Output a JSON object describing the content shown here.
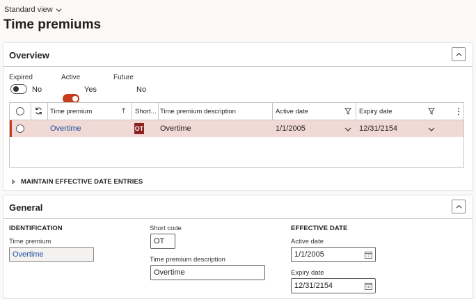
{
  "header": {
    "view_label": "Standard view",
    "title": "Time premiums"
  },
  "overview": {
    "title": "Overview",
    "toggles": [
      {
        "label": "Expired",
        "value": "No",
        "on": false
      },
      {
        "label": "Active",
        "value": "Yes",
        "on": true
      },
      {
        "label": "Future",
        "value": "No",
        "on": false
      }
    ],
    "grid": {
      "columns": [
        "Time premium",
        "Short...",
        "Time premium description",
        "Active date",
        "Expiry date"
      ],
      "rows": [
        {
          "time_premium": "Overtime",
          "short_code": "OT",
          "description": "Overtime",
          "active_date": "1/1/2005",
          "expiry_date": "12/31/2154"
        }
      ]
    },
    "maintain_label": "MAINTAIN EFFECTIVE DATE ENTRIES"
  },
  "general": {
    "title": "General",
    "identification_label": "IDENTIFICATION",
    "time_premium_label": "Time premium",
    "time_premium_value": "Overtime",
    "short_code_label": "Short code",
    "short_code_value": "OT",
    "description_label": "Time premium description",
    "description_value": "Overtime",
    "effective_label": "EFFECTIVE DATE",
    "active_date_label": "Active date",
    "active_date_value": "1/1/2005",
    "expiry_date_label": "Expiry date",
    "expiry_date_value": "12/31/2154"
  },
  "colors": {
    "accent": "#c43e1c",
    "selected_row": "#f1d9d6",
    "badge": "#8c2222",
    "link": "#1b4fa0"
  }
}
